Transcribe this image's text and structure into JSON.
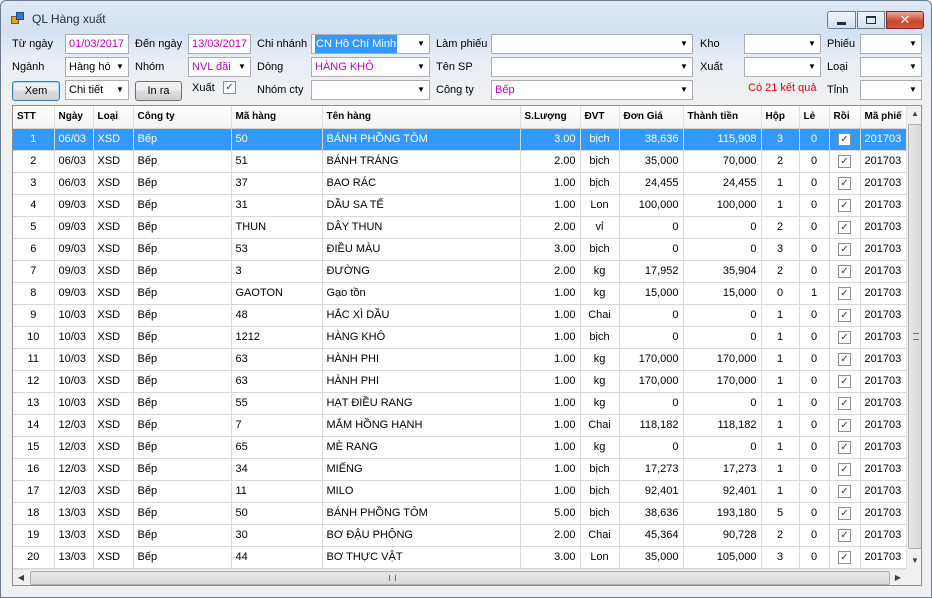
{
  "window": {
    "title": "QL Hàng xuất"
  },
  "filters": {
    "tu_ngay_label": "Từ ngày",
    "tu_ngay_value": "01/03/2017",
    "den_ngay_label": "Đến ngày",
    "den_ngay_value": "13/03/2017",
    "chi_nhanh_label": "Chi nhánh",
    "chi_nhanh_value": "CN Hồ Chí Minh",
    "lam_phieu_label": "Làm phiếu",
    "lam_phieu_value": "",
    "kho_label": "Kho",
    "kho_value": "",
    "phieu_label": "Phiếu",
    "phieu_value": "",
    "nganh_label": "Ngành",
    "nganh_value": "Hàng hó",
    "nhom_label": "Nhóm",
    "nhom_value": "NVL đầi",
    "dong_label": "Dòng",
    "dong_value": "HÀNG KHÔ",
    "ten_sp_label": "Tên SP",
    "ten_sp_value": "",
    "xuat_label": "Xuất",
    "xuat_value": "",
    "loai_label": "Loại",
    "loai_value": "",
    "xem_button": "Xem",
    "chi_tiet_value": "Chi tiết",
    "in_ra_button": "In ra",
    "xuat_check_label": "Xuất",
    "xuat_checked": "✓",
    "nhom_cty_label": "Nhóm cty",
    "nhom_cty_value": "",
    "cong_ty_label": "Công ty",
    "cong_ty_value": "Bếp",
    "tinh_label": "Tỉnh",
    "tinh_value": "",
    "result_text": "Có 21 kết quả"
  },
  "grid": {
    "headers": [
      "STT",
      "Ngày",
      "Loại",
      "Công ty",
      "Mã hàng",
      "Tên hàng",
      "S.Lượng",
      "ĐVT",
      "Đơn Giá",
      "Thành tiền",
      "Hộp",
      "Lẻ",
      "Rồi",
      "Mã phiế"
    ],
    "rows": [
      [
        "1",
        "06/03",
        "XSD",
        "Bếp",
        "50",
        "BÁNH PHỒNG TÔM",
        "3.00",
        "bịch",
        "38,636",
        "115,908",
        "3",
        "0",
        "✓",
        "201703"
      ],
      [
        "2",
        "06/03",
        "XSD",
        "Bếp",
        "51",
        "BÁNH TRÁNG",
        "2.00",
        "bịch",
        "35,000",
        "70,000",
        "2",
        "0",
        "✓",
        "201703"
      ],
      [
        "3",
        "06/03",
        "XSD",
        "Bếp",
        "37",
        "BAO RÁC",
        "1.00",
        "bịch",
        "24,455",
        "24,455",
        "1",
        "0",
        "✓",
        "201703"
      ],
      [
        "4",
        "09/03",
        "XSD",
        "Bếp",
        "31",
        "DẦU SA TẾ",
        "1.00",
        "Lon",
        "100,000",
        "100,000",
        "1",
        "0",
        "✓",
        "201703"
      ],
      [
        "5",
        "09/03",
        "XSD",
        "Bếp",
        "THUN",
        "DÂY THUN",
        "2.00",
        "vỉ",
        "0",
        "0",
        "2",
        "0",
        "✓",
        "201703"
      ],
      [
        "6",
        "09/03",
        "XSD",
        "Bếp",
        "53",
        "ĐIỀU MÀU",
        "3.00",
        "bịch",
        "0",
        "0",
        "3",
        "0",
        "✓",
        "201703"
      ],
      [
        "7",
        "09/03",
        "XSD",
        "Bếp",
        "3",
        "ĐƯỜNG",
        "2.00",
        "kg",
        "17,952",
        "35,904",
        "2",
        "0",
        "✓",
        "201703"
      ],
      [
        "8",
        "09/03",
        "XSD",
        "Bếp",
        "GAOTON",
        "Gạo tồn",
        "1.00",
        "kg",
        "15,000",
        "15,000",
        "0",
        "1",
        "✓",
        "201703"
      ],
      [
        "9",
        "10/03",
        "XSD",
        "Bếp",
        "48",
        "HẮC XÌ DẦU",
        "1.00",
        "Chai",
        "0",
        "0",
        "1",
        "0",
        "✓",
        "201703"
      ],
      [
        "10",
        "10/03",
        "XSD",
        "Bếp",
        "1212",
        "HÀNG KHÔ",
        "1.00",
        "bịch",
        "0",
        "0",
        "1",
        "0",
        "✓",
        "201703"
      ],
      [
        "11",
        "10/03",
        "XSD",
        "Bếp",
        "63",
        "HÀNH PHI",
        "1.00",
        "kg",
        "170,000",
        "170,000",
        "1",
        "0",
        "✓",
        "201703"
      ],
      [
        "12",
        "10/03",
        "XSD",
        "Bếp",
        "63",
        "HÀNH PHI",
        "1.00",
        "kg",
        "170,000",
        "170,000",
        "1",
        "0",
        "✓",
        "201703"
      ],
      [
        "13",
        "10/03",
        "XSD",
        "Bếp",
        "55",
        "HẠT ĐIỀU RANG",
        "1.00",
        "kg",
        "0",
        "0",
        "1",
        "0",
        "✓",
        "201703"
      ],
      [
        "14",
        "12/03",
        "XSD",
        "Bếp",
        "7",
        "MẮM HỒNG HẠNH",
        "1.00",
        "Chai",
        "118,182",
        "118,182",
        "1",
        "0",
        "✓",
        "201703"
      ],
      [
        "15",
        "12/03",
        "XSD",
        "Bếp",
        "65",
        "MÈ RANG",
        "1.00",
        "kg",
        "0",
        "0",
        "1",
        "0",
        "✓",
        "201703"
      ],
      [
        "16",
        "12/03",
        "XSD",
        "Bếp",
        "34",
        "MIẾNG",
        "1.00",
        "bịch",
        "17,273",
        "17,273",
        "1",
        "0",
        "✓",
        "201703"
      ],
      [
        "17",
        "12/03",
        "XSD",
        "Bếp",
        "11",
        "MILO",
        "1.00",
        "bịch",
        "92,401",
        "92,401",
        "1",
        "0",
        "✓",
        "201703"
      ],
      [
        "18",
        "13/03",
        "XSD",
        "Bếp",
        "50",
        "BÁNH PHỒNG TÔM",
        "5.00",
        "bịch",
        "38,636",
        "193,180",
        "5",
        "0",
        "✓",
        "201703"
      ],
      [
        "19",
        "13/03",
        "XSD",
        "Bếp",
        "30",
        "BƠ ĐẬU PHỘNG",
        "2.00",
        "Chai",
        "45,364",
        "90,728",
        "2",
        "0",
        "✓",
        "201703"
      ],
      [
        "20",
        "13/03",
        "XSD",
        "Bếp",
        "44",
        "BƠ THỰC VẬT",
        "3.00",
        "Lon",
        "35,000",
        "105,000",
        "3",
        "0",
        "✓",
        "201703"
      ]
    ]
  },
  "icons": {
    "dropdown": "▼",
    "scroll_up": "▲",
    "scroll_down": "▼",
    "scroll_left": "◀",
    "scroll_right": "▶",
    "close": "✕"
  }
}
